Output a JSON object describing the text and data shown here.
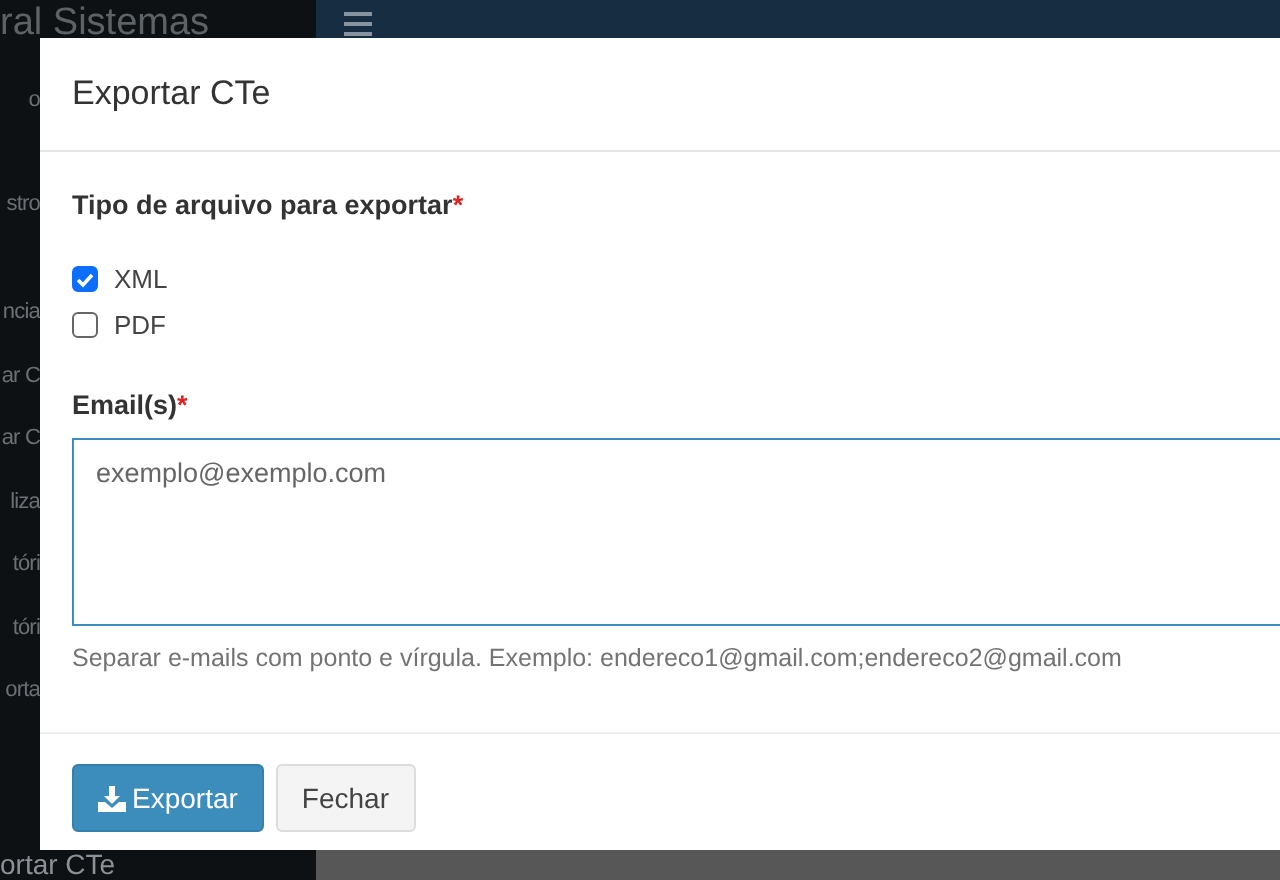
{
  "sidebar": {
    "brand": "ral Sistemas",
    "top_items": [
      "o",
      "stro"
    ],
    "menu_items": [
      "ncia",
      "ar C",
      "ar C",
      "liza",
      "tóri",
      "tóri",
      "orta"
    ],
    "last_item": "ortar CTe"
  },
  "modal": {
    "title": "Exportar CTe",
    "file_type": {
      "label": "Tipo de arquivo para exportar",
      "required_mark": "*",
      "options": [
        {
          "label": "XML",
          "checked": true
        },
        {
          "label": "PDF",
          "checked": false
        }
      ]
    },
    "emails": {
      "label": "Email(s)",
      "required_mark": "*",
      "placeholder": "exemplo@exemplo.com",
      "help": "Separar e-mails com ponto e vírgula. Exemplo: endereco1@gmail.com;endereco2@gmail.com"
    },
    "buttons": [
      {
        "label": "Exportar",
        "kind": "primary"
      },
      {
        "label": "Fechar",
        "kind": "default"
      }
    ]
  }
}
